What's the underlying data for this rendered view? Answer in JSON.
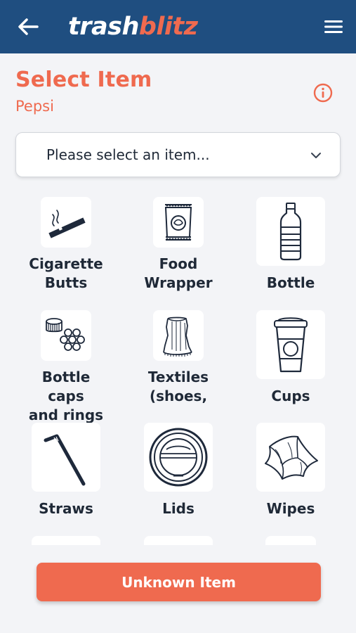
{
  "header": {
    "logo_part1": "trash",
    "logo_part2": "blitz",
    "back_icon": "arrow-left-icon",
    "menu_icon": "hamburger-menu-icon",
    "background_color": "#1f4e80"
  },
  "page": {
    "title": "Select Item",
    "subtitle": "Pepsi",
    "info_icon": "info-icon",
    "accent_color": "#ef6a4f"
  },
  "dropdown": {
    "selected_text": "Please select an item...",
    "chevron_icon": "chevron-down-icon"
  },
  "items": [
    {
      "label": "Cigarette\nButts",
      "icon": "cigarette-icon"
    },
    {
      "label": "Food\nWrapper",
      "icon": "food-wrapper-icon"
    },
    {
      "label": "Bottle",
      "icon": "bottle-icon"
    },
    {
      "label": "Bottle caps\nand rings",
      "icon": "bottle-caps-icon"
    },
    {
      "label": "Textiles\n(shoes,",
      "icon": "textiles-icon"
    },
    {
      "label": "Cups",
      "icon": "cup-icon"
    },
    {
      "label": "Straws",
      "icon": "straw-icon"
    },
    {
      "label": "Lids",
      "icon": "lid-icon"
    },
    {
      "label": "Wipes",
      "icon": "wipes-icon"
    }
  ],
  "footer": {
    "unknown_label": "Unknown Item"
  }
}
